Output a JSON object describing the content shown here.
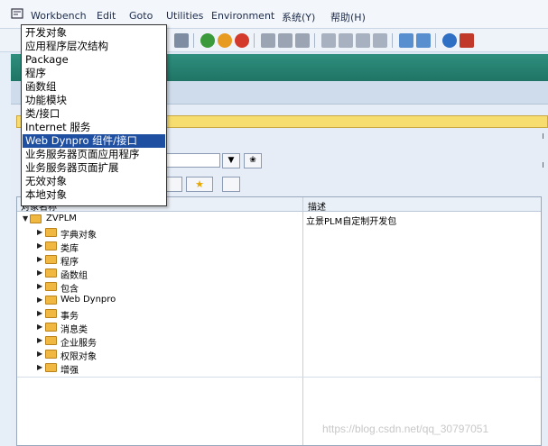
{
  "menubar": {
    "items": [
      {
        "label": "Workbench",
        "mnemonic": "W"
      },
      {
        "label": "Edit",
        "mnemonic": "E"
      },
      {
        "label": "Goto",
        "mnemonic": "G"
      },
      {
        "label": "Utilities",
        "mnemonic": "U"
      },
      {
        "label": "Environment",
        "mnemonic": "v"
      },
      {
        "label": "系统(Y)",
        "mnemonic": "Y"
      },
      {
        "label": "帮助(H)",
        "mnemonic": "H"
      }
    ]
  },
  "workbench_menu": {
    "items": [
      {
        "label": "开发对象"
      },
      {
        "label": "应用程序层次结构"
      },
      {
        "label": "Package"
      },
      {
        "label": "程序"
      },
      {
        "label": "函数组"
      },
      {
        "label": "功能模块"
      },
      {
        "label": "类/接口"
      },
      {
        "label": "Internet 服务"
      },
      {
        "label": "Web Dynpro 组件/接口",
        "selected": true
      },
      {
        "label": "业务服务器页面应用程序"
      },
      {
        "label": "业务服务器页面扩展"
      },
      {
        "label": "无效对象"
      },
      {
        "label": "本地对象"
      }
    ]
  },
  "combo": {
    "dropdown_glyph": "▼",
    "display_glyph": "❀"
  },
  "tree": {
    "header_col1": "对象名称",
    "header_col2": "描述",
    "root": {
      "label": "ZVPLM",
      "description": "立景PLM自定制开发包",
      "expanded": true
    },
    "children": [
      {
        "label": "字典对象"
      },
      {
        "label": "类库"
      },
      {
        "label": "程序"
      },
      {
        "label": "函数组"
      },
      {
        "label": "包含"
      },
      {
        "label": "Web Dynpro"
      },
      {
        "label": "事务"
      },
      {
        "label": "消息类"
      },
      {
        "label": "企业服务"
      },
      {
        "label": "权限对象"
      },
      {
        "label": "增强"
      }
    ]
  },
  "watermark": "https://blog.csdn.net/qq_30797051",
  "colors": {
    "title_bar": "#1f7465",
    "menu_selected": "#1f4fa1",
    "folder": "#f0b840",
    "yellow_bar": "#f7dc6f"
  },
  "icons": {
    "app_icon": "workbench-app-icon",
    "toolbar": [
      "save-icon",
      "back-icon",
      "exit-icon",
      "cancel-icon",
      "print-icon",
      "find-icon",
      "find-next-icon",
      "first-page-icon",
      "prev-page-icon",
      "next-page-icon",
      "last-page-icon",
      "new-session-icon",
      "shortcut-icon",
      "help-icon",
      "customize-icon"
    ]
  }
}
